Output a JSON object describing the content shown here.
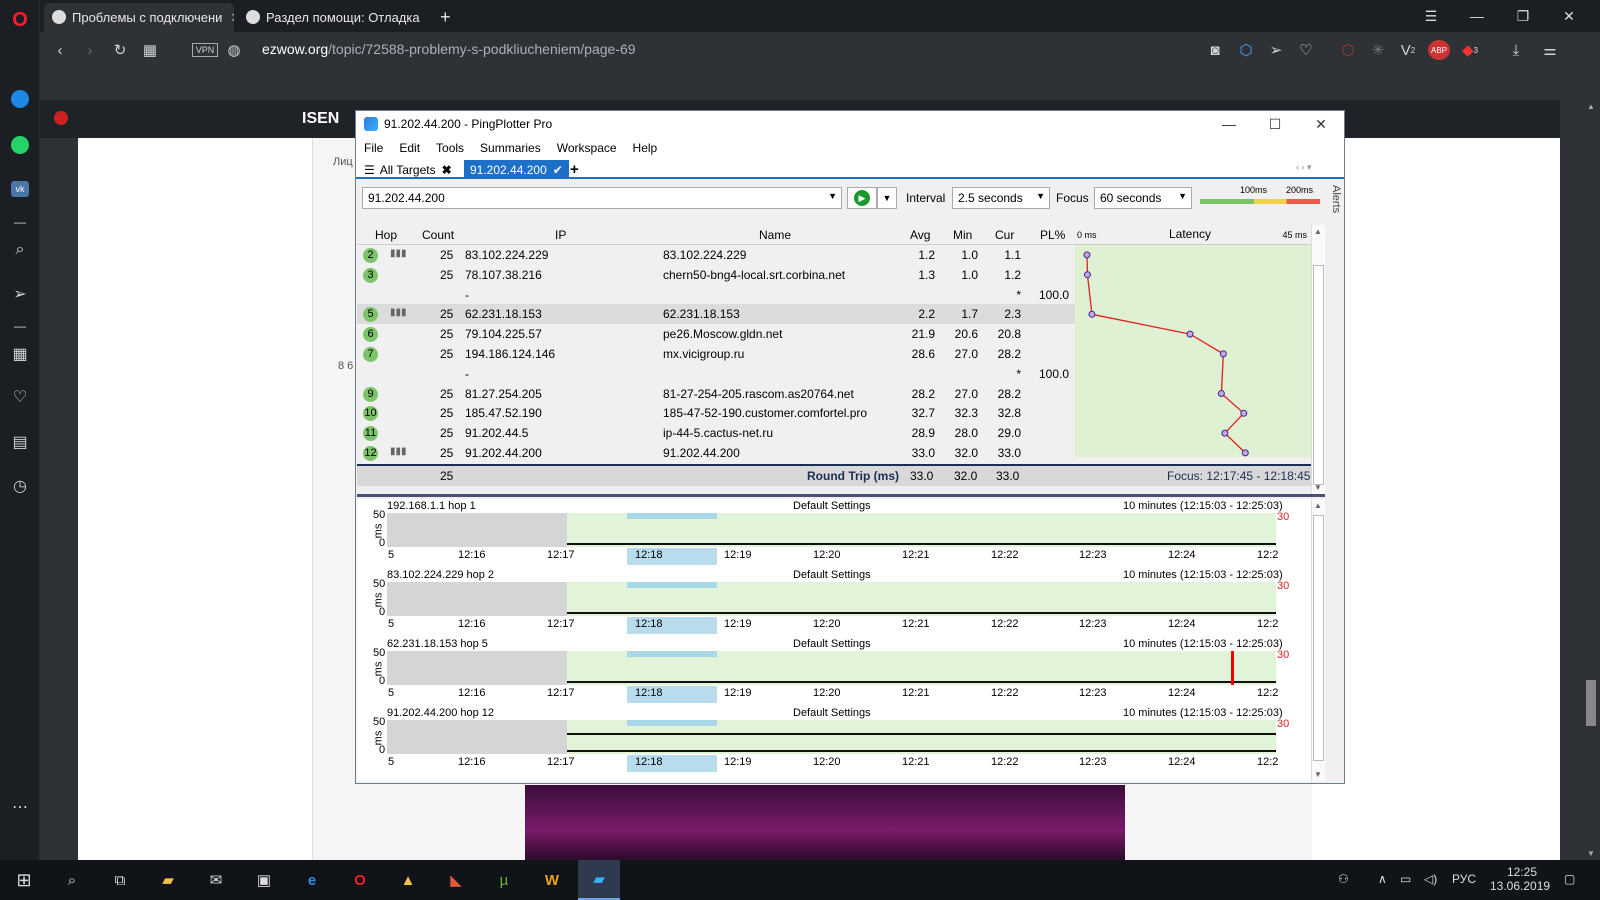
{
  "browser": {
    "tabs": [
      {
        "label": "Проблемы с подключени"
      },
      {
        "label": "Раздел помощи: Отладка"
      }
    ],
    "url_domain": "ezwow.org",
    "url_path": "/topic/72588-problemy-s-podkliucheniem/page-69",
    "vpn_label": "VPN",
    "badges": {
      "ext1": "2",
      "abp": "ABP",
      "ud": "3"
    }
  },
  "page": {
    "site_title": "ISEN",
    "left_label": "Лиц",
    "side_number": "8 6"
  },
  "pingplotter": {
    "title": "91.202.44.200 - PingPlotter Pro",
    "menu": [
      "File",
      "Edit",
      "Tools",
      "Summaries",
      "Workspace",
      "Help"
    ],
    "tabs": {
      "all_targets": "All Targets",
      "current": "91.202.44.200",
      "add": "+"
    },
    "target_input": "91.202.44.200",
    "interval_label": "Interval",
    "interval_value": "2.5 seconds",
    "focus_label": "Focus",
    "focus_value": "60 seconds",
    "legend": {
      "a": "100ms",
      "b": "200ms"
    },
    "alerts_label": "Alerts",
    "columns": {
      "hop": "Hop",
      "count": "Count",
      "ip": "IP",
      "name": "Name",
      "avg": "Avg",
      "min": "Min",
      "cur": "Cur",
      "pl": "PL%",
      "latency": "Latency",
      "lat_min": "0 ms",
      "lat_max": "45 ms"
    },
    "rows": [
      {
        "hop": "2",
        "count": "25",
        "ip": "83.102.224.229",
        "name": "83.102.224.229",
        "avg": "1.2",
        "min": "1.0",
        "cur": "1.1",
        "pl": "",
        "bars": true
      },
      {
        "hop": "3",
        "count": "25",
        "ip": "78.107.38.216",
        "name": "chern50-bng4-local.srt.corbina.net",
        "avg": "1.3",
        "min": "1.0",
        "cur": "1.2",
        "pl": "",
        "bars": false
      },
      {
        "hop": "",
        "count": "",
        "ip": "-",
        "name": "",
        "avg": "",
        "min": "",
        "cur": "*",
        "pl": "100.0",
        "bars": false
      },
      {
        "hop": "5",
        "count": "25",
        "ip": "62.231.18.153",
        "name": "62.231.18.153",
        "avg": "2.2",
        "min": "1.7",
        "cur": "2.3",
        "pl": "",
        "bars": true
      },
      {
        "hop": "6",
        "count": "25",
        "ip": "79.104.225.57",
        "name": "pe26.Moscow.gldn.net",
        "avg": "21.9",
        "min": "20.6",
        "cur": "20.8",
        "pl": "",
        "bars": false
      },
      {
        "hop": "7",
        "count": "25",
        "ip": "194.186.124.146",
        "name": "mx.vicigroup.ru",
        "avg": "28.6",
        "min": "27.0",
        "cur": "28.2",
        "pl": "",
        "bars": false
      },
      {
        "hop": "",
        "count": "",
        "ip": "-",
        "name": "",
        "avg": "",
        "min": "",
        "cur": "*",
        "pl": "100.0",
        "bars": false
      },
      {
        "hop": "9",
        "count": "25",
        "ip": "81.27.254.205",
        "name": "81-27-254-205.rascom.as20764.net",
        "avg": "28.2",
        "min": "27.0",
        "cur": "28.2",
        "pl": "",
        "bars": false
      },
      {
        "hop": "10",
        "count": "25",
        "ip": "185.47.52.190",
        "name": "185-47-52-190.customer.comfortel.pro",
        "avg": "32.7",
        "min": "32.3",
        "cur": "32.8",
        "pl": "",
        "bars": false
      },
      {
        "hop": "11",
        "count": "25",
        "ip": "91.202.44.5",
        "name": "ip-44-5.cactus-net.ru",
        "avg": "28.9",
        "min": "28.0",
        "cur": "29.0",
        "pl": "",
        "bars": false
      },
      {
        "hop": "12",
        "count": "25",
        "ip": "91.202.44.200",
        "name": "91.202.44.200",
        "avg": "33.0",
        "min": "32.0",
        "cur": "33.0",
        "pl": "",
        "bars": true
      }
    ],
    "summary": {
      "count": "25",
      "label": "Round Trip (ms)",
      "avg": "33.0",
      "min": "32.0",
      "cur": "33.0",
      "focus": "Focus: 12:17:45 - 12:18:45"
    },
    "strips": [
      {
        "title": "192.168.1.1 hop 1",
        "settings": "Default Settings",
        "range": "10 minutes (12:15:03 - 12:25:03)",
        "ymax": "50",
        "yunit": "ms",
        "yzero": "0",
        "right": "30"
      },
      {
        "title": "83.102.224.229 hop 2",
        "settings": "Default Settings",
        "range": "10 minutes (12:15:03 - 12:25:03)",
        "ymax": "50",
        "yunit": "ms",
        "yzero": "0",
        "right": "30"
      },
      {
        "title": "62.231.18.153 hop 5",
        "settings": "Default Settings",
        "range": "10 minutes (12:15:03 - 12:25:03)",
        "ymax": "50",
        "yunit": "ms",
        "yzero": "0",
        "right": "30"
      },
      {
        "title": "91.202.44.200 hop 12",
        "settings": "Default Settings",
        "range": "10 minutes (12:15:03 - 12:25:03)",
        "ymax": "50",
        "yunit": "ms",
        "yzero": "0",
        "right": "30"
      }
    ],
    "xticks": [
      "5",
      "12:16",
      "12:17",
      "12:18",
      "12:19",
      "12:20",
      "12:21",
      "12:22",
      "12:23",
      "12:24",
      "12:2"
    ]
  },
  "taskbar": {
    "lang": "РУС",
    "time": "12:25",
    "date": "13.06.2019"
  },
  "colors": {
    "accent": "#1e6fc8",
    "hop_green": "#7cc46a",
    "latency_bg": "#dff0d3",
    "trace_red": "#e02020"
  }
}
